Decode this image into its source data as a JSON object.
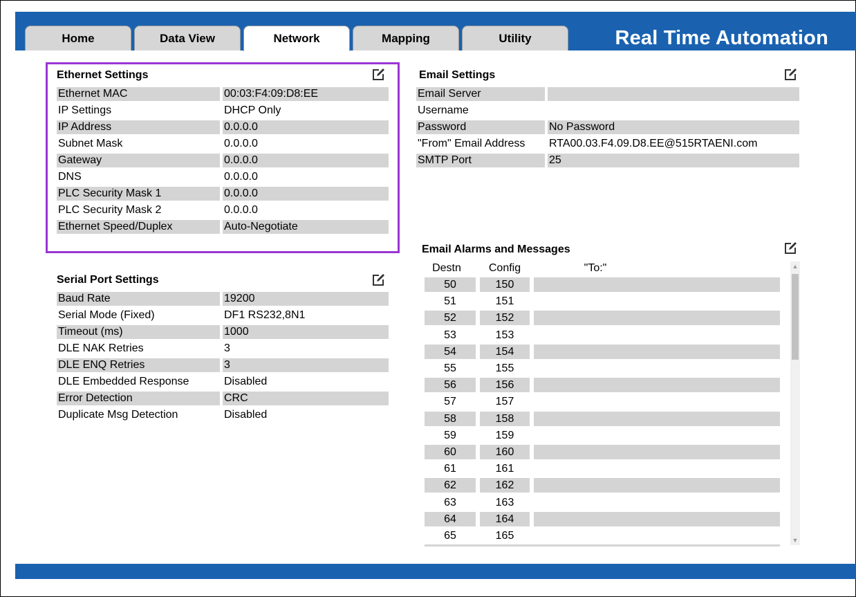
{
  "tabs": [
    {
      "label": "Home"
    },
    {
      "label": "Data View"
    },
    {
      "label": "Network"
    },
    {
      "label": "Mapping"
    },
    {
      "label": "Utility"
    }
  ],
  "active_tab": "Network",
  "brand": "Real Time Automation",
  "ethernet": {
    "title": "Ethernet Settings",
    "rows": [
      {
        "label": "Ethernet MAC",
        "value": "00:03:F4:09:D8:EE"
      },
      {
        "label": "IP Settings",
        "value": "DHCP Only"
      },
      {
        "label": "IP Address",
        "value": "0.0.0.0"
      },
      {
        "label": "Subnet Mask",
        "value": "0.0.0.0"
      },
      {
        "label": "Gateway",
        "value": "0.0.0.0"
      },
      {
        "label": "DNS",
        "value": "0.0.0.0"
      },
      {
        "label": "PLC Security Mask 1",
        "value": "0.0.0.0"
      },
      {
        "label": "PLC Security Mask 2",
        "value": "0.0.0.0"
      },
      {
        "label": "Ethernet Speed/Duplex",
        "value": "Auto-Negotiate"
      }
    ]
  },
  "serial": {
    "title": "Serial Port Settings",
    "rows": [
      {
        "label": "Baud Rate",
        "value": "19200"
      },
      {
        "label": "Serial Mode (Fixed)",
        "value": "DF1 RS232,8N1"
      },
      {
        "label": "Timeout (ms)",
        "value": "1000"
      },
      {
        "label": "DLE NAK Retries",
        "value": "3"
      },
      {
        "label": "DLE ENQ Retries",
        "value": "3"
      },
      {
        "label": "DLE Embedded Response",
        "value": "Disabled"
      },
      {
        "label": "Error Detection",
        "value": "CRC"
      },
      {
        "label": "Duplicate Msg Detection",
        "value": "Disabled"
      }
    ]
  },
  "email": {
    "title": "Email Settings",
    "rows": [
      {
        "label": "Email Server",
        "value": ""
      },
      {
        "label": "Username",
        "value": ""
      },
      {
        "label": "Password",
        "value": "No Password"
      },
      {
        "label": "\"From\" Email Address",
        "value": "RTA00.03.F4.09.D8.EE@515RTAENI.com"
      },
      {
        "label": "SMTP Port",
        "value": "25"
      }
    ]
  },
  "alarms": {
    "title": "Email Alarms and Messages",
    "headers": {
      "destn": "Destn",
      "config": "Config",
      "to": "\"To:\""
    },
    "rows": [
      {
        "destn": "50",
        "config": "150",
        "to": ""
      },
      {
        "destn": "51",
        "config": "151",
        "to": ""
      },
      {
        "destn": "52",
        "config": "152",
        "to": ""
      },
      {
        "destn": "53",
        "config": "153",
        "to": ""
      },
      {
        "destn": "54",
        "config": "154",
        "to": ""
      },
      {
        "destn": "55",
        "config": "155",
        "to": ""
      },
      {
        "destn": "56",
        "config": "156",
        "to": ""
      },
      {
        "destn": "57",
        "config": "157",
        "to": ""
      },
      {
        "destn": "58",
        "config": "158",
        "to": ""
      },
      {
        "destn": "59",
        "config": "159",
        "to": ""
      },
      {
        "destn": "60",
        "config": "160",
        "to": ""
      },
      {
        "destn": "61",
        "config": "161",
        "to": ""
      },
      {
        "destn": "62",
        "config": "162",
        "to": ""
      },
      {
        "destn": "63",
        "config": "163",
        "to": ""
      },
      {
        "destn": "64",
        "config": "164",
        "to": ""
      },
      {
        "destn": "65",
        "config": "165",
        "to": ""
      }
    ]
  },
  "colors": {
    "brand_blue": "#1a62b0",
    "highlight_purple": "#9b35d4",
    "row_shade": "#d4d4d4"
  }
}
